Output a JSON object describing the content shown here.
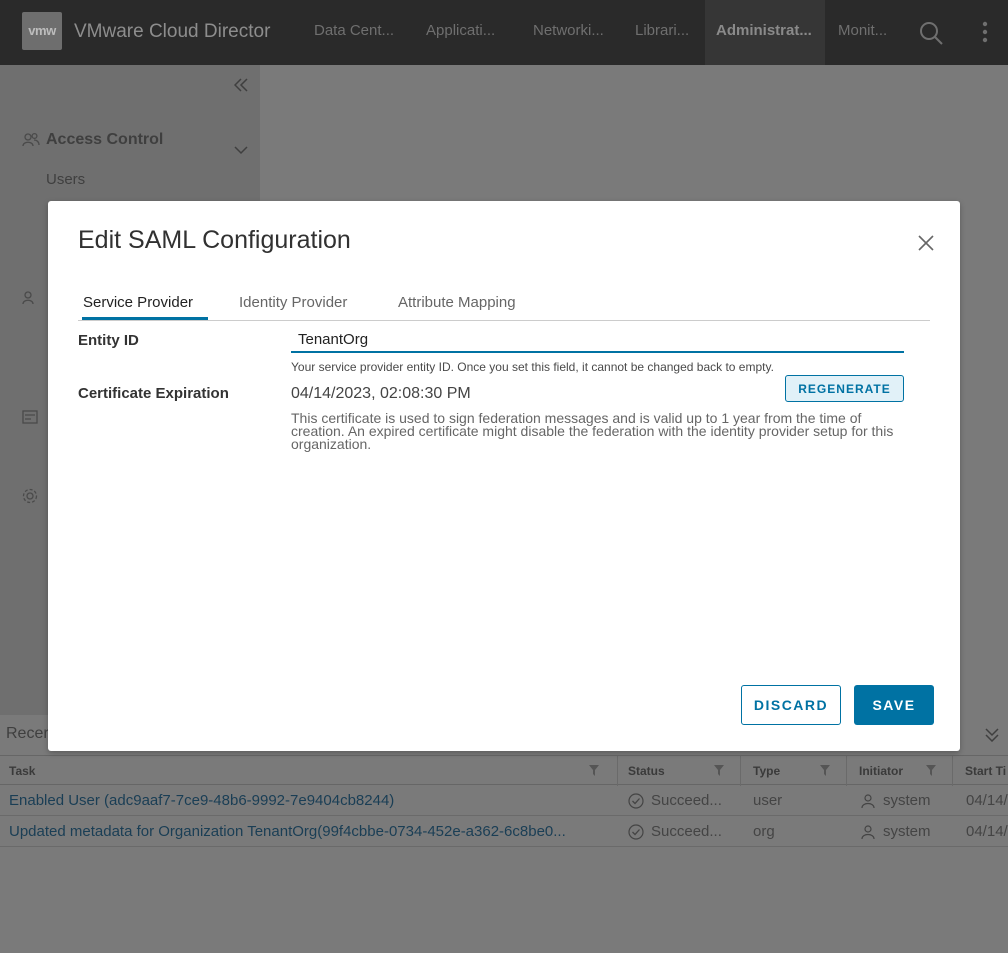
{
  "header": {
    "logo_text": "vmw",
    "app_title": "VMware Cloud Director",
    "nav": [
      "Data Cent...",
      "Applicati...",
      "Networki...",
      "Librari...",
      "Administrat...",
      "Monit..."
    ],
    "active_nav": "Administrat..."
  },
  "sidebar": {
    "section_title": "Access Control",
    "items": [
      "Users"
    ]
  },
  "recent_tasks": {
    "title": "Recer",
    "columns": [
      "Task",
      "Status",
      "Type",
      "Initiator",
      "Start Ti"
    ],
    "rows": [
      {
        "task": "Enabled User (adc9aaf7-7ce9-48b6-9992-7e9404cb8244)",
        "status": "Succeed...",
        "type": "user",
        "initiator": "system",
        "start": "04/14/"
      },
      {
        "task": "Updated metadata for Organization TenantOrg(99f4cbbe-0734-452e-a362-6c8be0...",
        "status": "Succeed...",
        "type": "org",
        "initiator": "system",
        "start": "04/14/"
      }
    ]
  },
  "modal": {
    "title": "Edit SAML Configuration",
    "tabs": [
      "Service Provider",
      "Identity Provider",
      "Attribute Mapping"
    ],
    "active_tab": "Service Provider",
    "entity_id_label": "Entity ID",
    "entity_id_value": "TenantOrg",
    "entity_id_helper": "Your service provider entity ID. Once you set this field, it cannot be changed back to empty.",
    "cert_label": "Certificate Expiration",
    "cert_date": "04/14/2023, 02:08:30 PM",
    "regenerate_label": "REGENERATE",
    "cert_desc": "This certificate is used to sign federation messages and is valid up to 1 year from the time of creation. An expired certificate might disable the federation with the identity provider setup for this organization.",
    "discard_label": "DISCARD",
    "save_label": "SAVE"
  },
  "colors": {
    "accent": "#0072a3",
    "header_bg": "#2a2a2a",
    "overlay_bg": "#7a7a7a"
  }
}
